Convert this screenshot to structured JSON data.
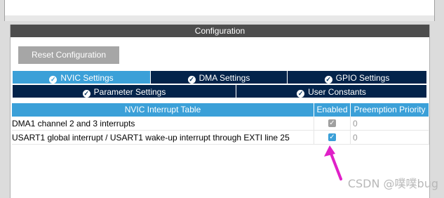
{
  "config": {
    "header": "Configuration",
    "reset_label": "Reset Configuration"
  },
  "tabs": [
    {
      "label": "NVIC Settings",
      "active": true,
      "icon": "check-circle-icon"
    },
    {
      "label": "DMA Settings",
      "active": false,
      "icon": "check-circle-icon"
    },
    {
      "label": "GPIO Settings",
      "active": false,
      "icon": "check-circle-icon"
    },
    {
      "label": "Parameter Settings",
      "active": false,
      "icon": "check-circle-icon"
    },
    {
      "label": "User Constants",
      "active": false,
      "icon": "check-circle-icon"
    }
  ],
  "table": {
    "headers": [
      "NVIC Interrupt Table",
      "Enabled",
      "Preemption Priority"
    ],
    "rows": [
      {
        "name": "DMA1 channel 2 and 3 interrupts",
        "enabled": true,
        "editable": false,
        "priority": "0"
      },
      {
        "name": "USART1 global interrupt / USART1 wake-up interrupt through EXTI line 25",
        "enabled": true,
        "editable": true,
        "priority": "0"
      }
    ]
  },
  "watermark": "CSDN @噗噗bug",
  "colors": {
    "tab_active": "#3ba0d8",
    "tab_inactive": "#03234a",
    "header_dark": "#4d4d4d",
    "arrow": "#e020c8"
  }
}
